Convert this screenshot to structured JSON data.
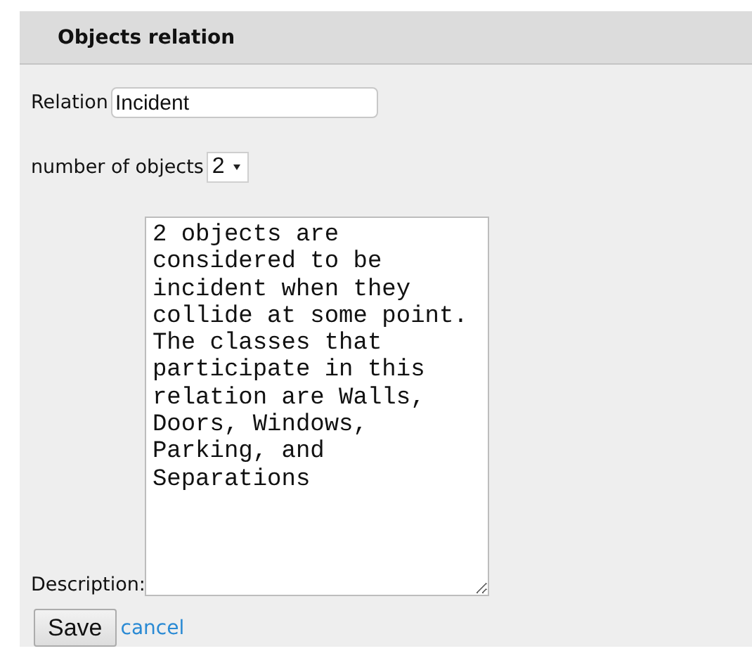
{
  "panel": {
    "title": "Objects relation"
  },
  "relation": {
    "label": "Relation",
    "value": "Incident"
  },
  "object_count": {
    "label": "number of objects",
    "value": "2"
  },
  "description": {
    "label": "Description:",
    "value": "2 objects are considered to be incident when they collide at some point. The classes that participate in this relation are Walls, Doors, Windows, Parking, and Separations"
  },
  "actions": {
    "save": "Save",
    "cancel": "cancel"
  }
}
